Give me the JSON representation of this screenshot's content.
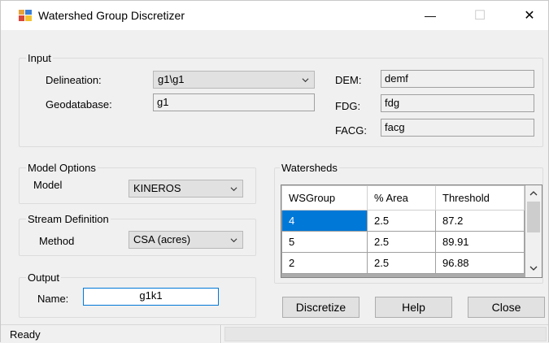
{
  "window": {
    "title": "Watershed Group Discretizer",
    "minimize_glyph": "—",
    "maximize_glyph": "☐",
    "close_glyph": "✕"
  },
  "input_group": {
    "label": "Input",
    "delineation_label": "Delineation:",
    "delineation_value": "g1\\g1",
    "geodatabase_label": "Geodatabase:",
    "geodatabase_value": "g1",
    "dem_label": "DEM:",
    "dem_value": "demf",
    "fdg_label": "FDG:",
    "fdg_value": "fdg",
    "facg_label": "FACG:",
    "facg_value": "facg"
  },
  "model_options": {
    "label": "Model Options",
    "model_label": "Model",
    "model_value": "KINEROS"
  },
  "stream_definition": {
    "label": "Stream Definition",
    "method_label": "Method",
    "method_value": "CSA (acres)"
  },
  "output": {
    "label": "Output",
    "name_label": "Name:",
    "name_value": "g1k1"
  },
  "watersheds": {
    "label": "Watersheds",
    "columns": [
      "WSGroup",
      "% Area",
      "Threshold"
    ],
    "rows": [
      [
        "4",
        "2.5",
        "87.2"
      ],
      [
        "5",
        "2.5",
        "89.91"
      ],
      [
        "2",
        "2.5",
        "96.88"
      ]
    ],
    "selected_row": 0
  },
  "buttons": {
    "discretize": "Discretize",
    "help": "Help",
    "close": "Close"
  },
  "status": {
    "text": "Ready"
  },
  "icons": {
    "app": "app-grid-icon",
    "dropdown": "chevron-down-icon"
  },
  "colors": {
    "selection": "#0078d7",
    "window_bg": "#f0f0f0"
  }
}
